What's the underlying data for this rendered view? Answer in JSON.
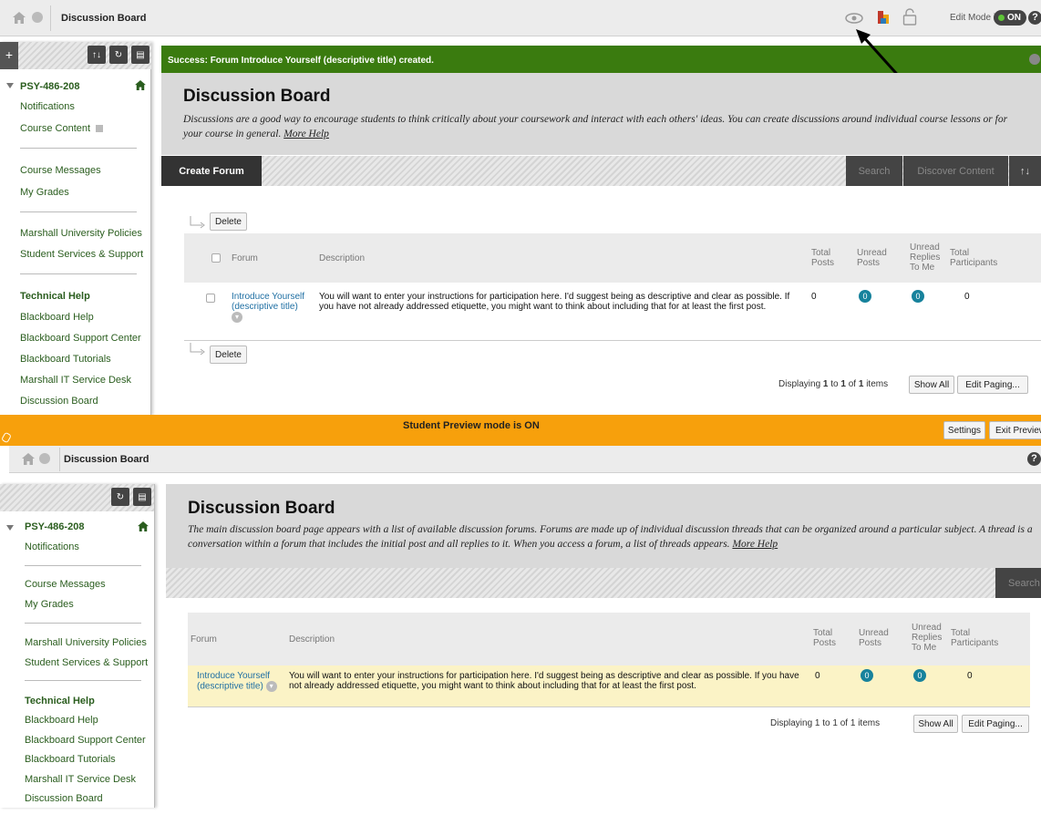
{
  "top": {
    "breadcrumb": "Discussion Board",
    "edit_mode_label": "Edit Mode is:",
    "edit_mode_state": "ON"
  },
  "sidebar": {
    "course": "PSY-486-208",
    "items_group1": [
      "Notifications",
      "Course Content"
    ],
    "items_group2": [
      "Course Messages",
      "My Grades"
    ],
    "items_group3": [
      "Marshall University Policies",
      "Student Services & Support"
    ],
    "technical_help": "Technical Help",
    "items_group4": [
      "Blackboard Help",
      "Blackboard Support Center",
      "Blackboard Tutorials",
      "Marshall IT Service Desk",
      "Discussion Board"
    ]
  },
  "success_message": "Success: Forum Introduce Yourself (descriptive title) created.",
  "instructor": {
    "title": "Discussion Board",
    "description": "Discussions are a good way to encourage students to think critically about your coursework and interact with each others' ideas. You can create discussions around individual course lessons or for your course in general.",
    "more_help": "More Help",
    "create_forum": "Create Forum",
    "search": "Search",
    "discover_content": "Discover Content",
    "delete": "Delete",
    "columns": {
      "forum": "Forum",
      "description": "Description",
      "total_posts": "Total Posts",
      "unread_posts": "Unread Posts",
      "unread_replies": "Unread Replies To Me",
      "total_participants": "Total Participants"
    },
    "row": {
      "forum": "Introduce Yourself (descriptive title)",
      "description": "You will want to enter your instructions for participation here. I'd suggest being as descriptive and clear as possible. If you have not already addressed etiquette, you might want to think about including that for at least the first post.",
      "total_posts": "0",
      "unread_posts": "0",
      "unread_replies": "0",
      "total_participants": "0"
    },
    "paging_prefix": "Displaying",
    "paging_from": "1",
    "paging_to_word": "to",
    "paging_to": "1",
    "paging_of_word": "of",
    "paging_total": "1",
    "paging_suffix": "items",
    "show_all": "Show All",
    "edit_paging": "Edit Paging..."
  },
  "preview_banner": {
    "text": "Student Preview mode is ON",
    "settings": "Settings",
    "exit": "Exit Preview"
  },
  "student": {
    "title": "Discussion Board",
    "description": "The main discussion board page appears with a list of available discussion forums. Forums are made up of individual discussion threads that can be organized around a particular subject. A thread is a conversation within a forum that includes the initial post and all replies to it. When you access a forum, a list of threads appears.",
    "more_help": "More Help",
    "search": "Search"
  },
  "colors": {
    "success": "#3a7b0f",
    "preview": "#f7a00c",
    "link": "#1f6fa3",
    "nav_green": "#2a5d1e",
    "badge": "#17829c",
    "highlight_row": "#fbf3c6"
  }
}
